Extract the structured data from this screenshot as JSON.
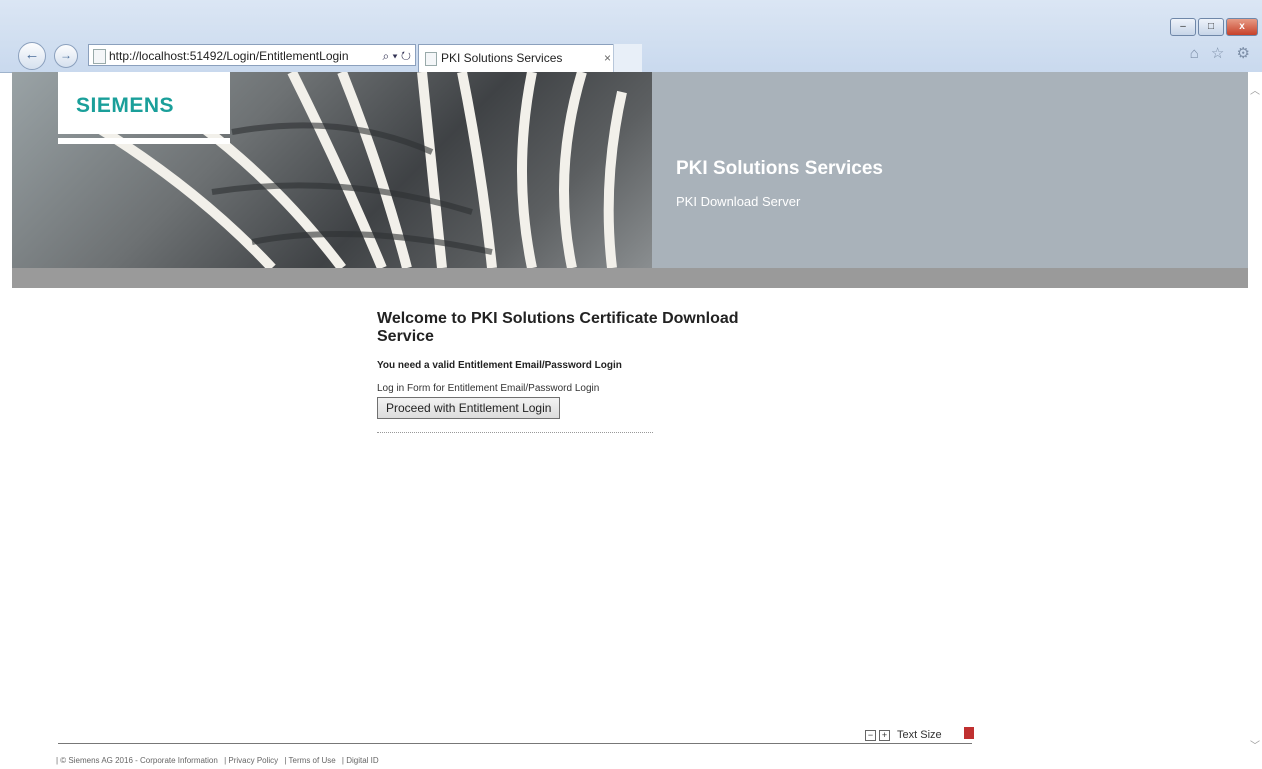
{
  "browser": {
    "url": "http://localhost:51492/Login/EntitlementLogin",
    "tab_title": "PKI Solutions Services",
    "tab_close": "×",
    "address_tools": "⌕ ▾ ↻",
    "window_buttons": {
      "minimize": "–",
      "maximize": "□",
      "close": "x"
    },
    "right_icons": "⌂ ☆ ⚙"
  },
  "header": {
    "logo": "SIEMENS",
    "title": "PKI Solutions Services",
    "subtitle": "PKI Download Server"
  },
  "main": {
    "heading": "Welcome to PKI Solutions Certificate Download Service",
    "requirement": "You need a valid Entitlement Email/Password Login",
    "form_label": "Log in Form for Entitlement Email/Password Login",
    "proceed_button": "Proceed with Entitlement Login"
  },
  "text_size": {
    "minus": "−",
    "plus": "+",
    "label": "Text Size"
  },
  "footer": {
    "copyright": "| © Siemens AG 2016 - Corporate Information",
    "privacy": "| Privacy Policy",
    "terms": "| Terms of Use",
    "digital_id": "| Digital ID"
  }
}
